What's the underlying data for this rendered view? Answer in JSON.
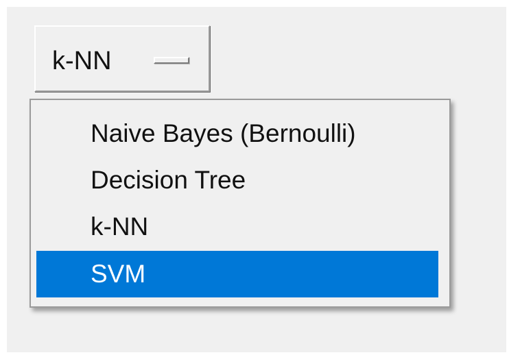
{
  "option_menu": {
    "current_value": "k-NN"
  },
  "dropdown": {
    "items": [
      {
        "label": "Naive Bayes (Bernoulli)",
        "highlighted": false
      },
      {
        "label": "Decision Tree",
        "highlighted": false
      },
      {
        "label": "k-NN",
        "highlighted": false
      },
      {
        "label": "SVM",
        "highlighted": true
      }
    ]
  },
  "colors": {
    "window_background": "#f0f0f0",
    "highlight": "#0078d7",
    "highlight_text": "#ffffff",
    "text": "#111111"
  }
}
